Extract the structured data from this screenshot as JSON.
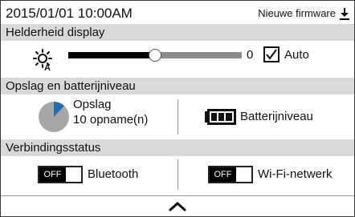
{
  "status": {
    "datetime": "2015/01/01  10:00AM",
    "firmware_label": "Nieuwe firmware",
    "firmware_icon": "download-icon"
  },
  "brightness": {
    "header": "Helderheid display",
    "icon": "brightness-auto-icon",
    "value": "0",
    "level": 0.5,
    "auto_label": "Auto",
    "auto_checked": true
  },
  "storage_section": {
    "header": "Opslag en batterijniveau",
    "storage_title": "Opslag",
    "storage_count": "10 opname(n)",
    "storage_used_fraction": 0.12,
    "battery_label": "Batterijniveau",
    "battery_icon": "battery-full-icon"
  },
  "connection": {
    "header": "Verbindingsstatus",
    "bluetooth_toggle": "OFF",
    "bluetooth_label": "Bluetooth",
    "wifi_toggle": "OFF",
    "wifi_label": "Wi-Fi-netwerk"
  },
  "footer": {
    "expand_icon": "chevron-up-icon"
  },
  "colors": {
    "header_bg": "#d9d9d9",
    "accent": "#1f6fb2",
    "pie_bg": "#a6a6a6"
  }
}
